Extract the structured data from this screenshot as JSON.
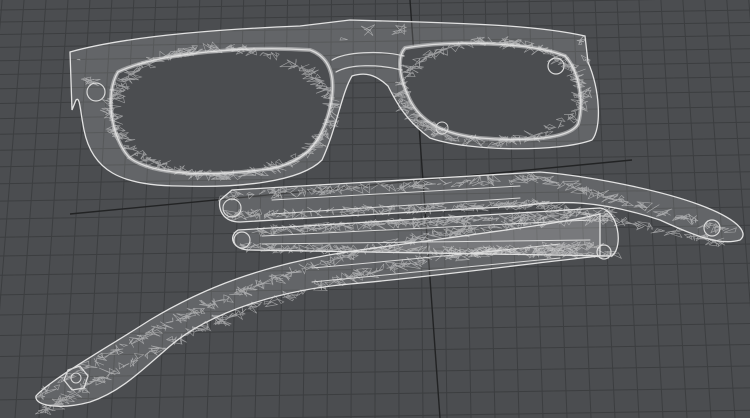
{
  "viewport": {
    "background": "#4b4d50",
    "grid_color": "#3c3e40",
    "axis_color": "#222324",
    "wire_color": "#dcdcdc",
    "display_mode": "wireframe"
  },
  "scene": {
    "objects": [
      {
        "name": "eyeglass-front-frame",
        "kind": "mesh"
      },
      {
        "name": "temple-arm-upper",
        "kind": "mesh"
      },
      {
        "name": "temple-arm-middle",
        "kind": "mesh"
      },
      {
        "name": "temple-arm-lower",
        "kind": "mesh"
      }
    ]
  }
}
